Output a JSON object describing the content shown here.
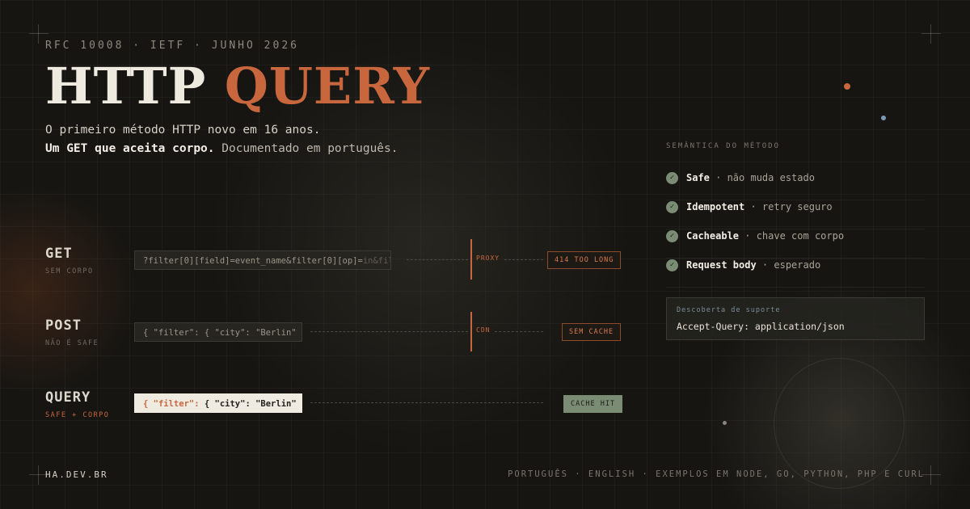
{
  "meta": "RFC 10008 · IETF · JUNHO 2026",
  "title": {
    "part1": "HTTP",
    "part2": "QUERY"
  },
  "subtitle": {
    "line1": "O primeiro método HTTP novo em 16 anos.",
    "line2_bold": "Um GET que aceita corpo.",
    "line2_rest": " Documentado em português."
  },
  "methods": {
    "get": {
      "name": "GET",
      "note": "SEM CORPO",
      "request": "?filter[0][field]=event_name&filter[0][op]=",
      "request_fade": "in&filt",
      "mid_label": "PROXY",
      "badge": "414 TOO LONG"
    },
    "post": {
      "name": "POST",
      "note": "NÃO É SAFE",
      "request": "{ \"filter\": { \"city\": \"Berlin\" }",
      "mid_label": "CDN",
      "badge": "SEM CACHE"
    },
    "query": {
      "name": "QUERY",
      "note": "SAFE + CORPO",
      "request_key": "{ \"filter\":",
      "request_rest": " { \"city\": \"Berlin\" }",
      "badge": "CACHE HIT"
    }
  },
  "semantics": {
    "heading": "SEMÂNTICA DO MÉTODO",
    "items": [
      {
        "name": "Safe",
        "desc": " · não muda estado"
      },
      {
        "name": "Idempotent",
        "desc": " · retry seguro"
      },
      {
        "name": "Cacheable",
        "desc": " · chave com corpo"
      },
      {
        "name": "Request body",
        "desc": " · esperado"
      }
    ],
    "check_glyph": "✓"
  },
  "support": {
    "label": "Descoberta de suporte",
    "value": "Accept-Query: application/json"
  },
  "footer": {
    "left": "HA.DEV.BR",
    "right": "PORTUGUÊS · ENGLISH · EXEMPLOS EM NODE, GO, PYTHON, PHP E CURL"
  },
  "colors": {
    "accent": "#c8673d",
    "ok": "#7a8c74",
    "background": "#161512"
  }
}
